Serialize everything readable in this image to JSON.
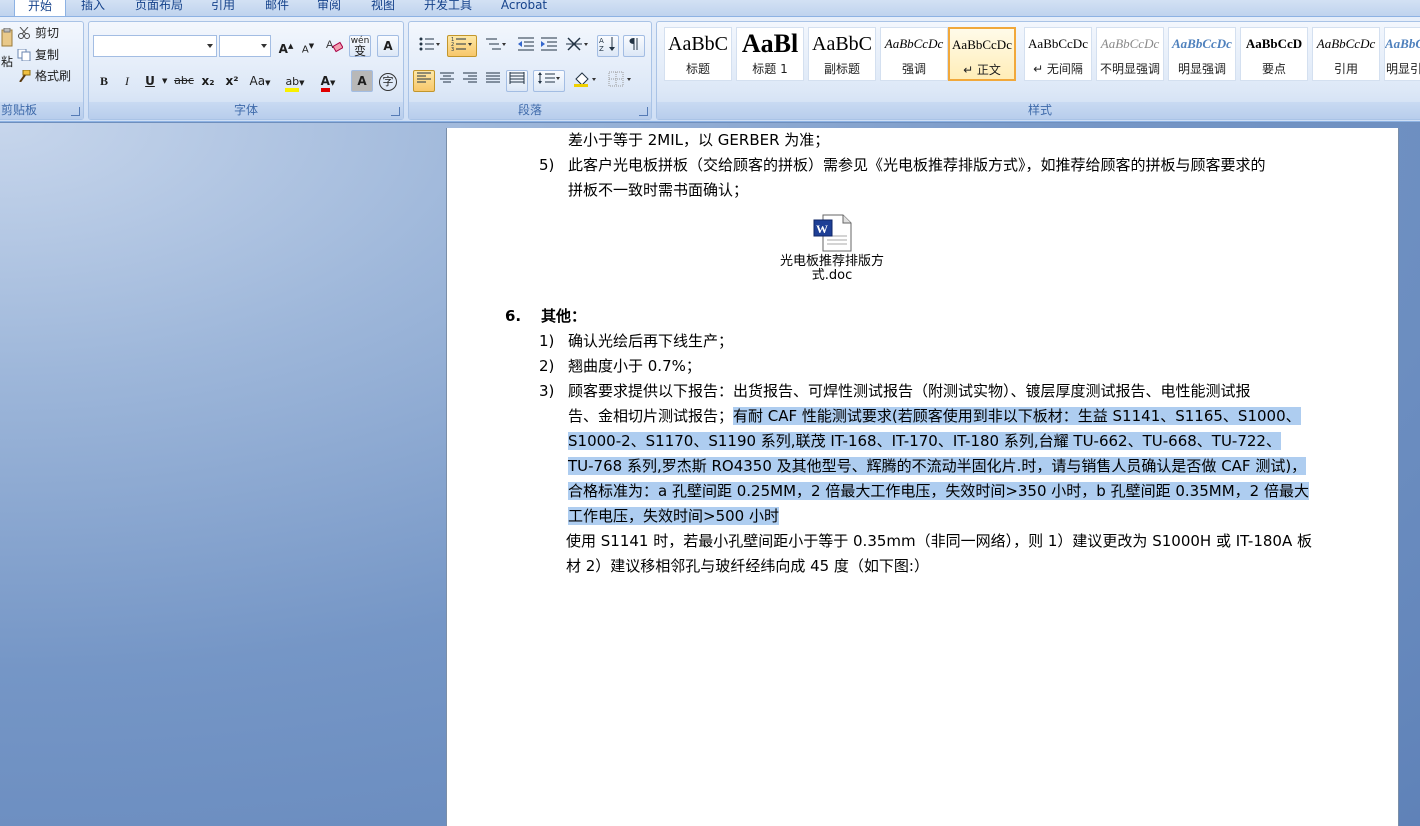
{
  "tabs": [
    "开始",
    "插入",
    "页面布局",
    "引用",
    "邮件",
    "审阅",
    "视图",
    "开发工具",
    "Acrobat"
  ],
  "clipboard": {
    "paste": "粘",
    "cut": "剪切",
    "copy": "复制",
    "format_painter": "格式刷",
    "group_label": "剪贴板"
  },
  "font": {
    "group_label": "字体",
    "grow": "A",
    "shrink": "A",
    "bold": "B",
    "italic": "I",
    "underline": "U",
    "strike": "abc",
    "subscript": "x₂",
    "superscript": "x²",
    "case": "Aa",
    "highlight": "ab",
    "color": "A",
    "pinyin": "wén",
    "border_a": "A",
    "shade_a": "A",
    "circle": "字"
  },
  "paragraph": {
    "group_label": "段落"
  },
  "styles": {
    "group_label": "样式",
    "items": [
      {
        "sample": "AaBbC",
        "name": "标题"
      },
      {
        "sample": "AaBl",
        "name": "标题 1"
      },
      {
        "sample": "AaBbC",
        "name": "副标题"
      },
      {
        "sample": "AaBbCcDc",
        "name": "强调"
      },
      {
        "sample": "AaBbCcDc",
        "name": "↵ 正文"
      },
      {
        "sample": "AaBbCcDc",
        "name": "↵ 无间隔"
      },
      {
        "sample": "AaBbCcDc",
        "name": "不明显强调"
      },
      {
        "sample": "AaBbCcDc",
        "name": "明显强调"
      },
      {
        "sample": "AaBbCcD",
        "name": "要点"
      },
      {
        "sample": "AaBbCcDc",
        "name": "引用"
      },
      {
        "sample": "AaBbCcDc",
        "name": "明显引"
      }
    ]
  },
  "document": {
    "line_top": "差小于等于 2MIL，以 GERBER 为准；",
    "item5_num": "5)",
    "item5_l1": "此客户光电板拼板（交给顾客的拼板）需参见《光电板推荐排版方式》，如推荐给顾客的拼板与顾客要求的",
    "item5_l2": "拼板不一致时需书面确认；",
    "attachment_l1": "光电板推荐排版方",
    "attachment_l2": "式.doc",
    "section_num": "6.",
    "section_title": "其他：",
    "o1_num": "1)",
    "o1": "确认光绘后再下线生产；",
    "o2_num": "2)",
    "o2": "翘曲度小于 0.7%；",
    "o3_num": "3)",
    "o3_l1": "顾客要求提供以下报告：出货报告、可焊性测试报告（附测试实物）、镀层厚度测试报告、电性能测试报",
    "o3_l2a": "告、金相切片测试报告；",
    "o3_l2b": "有耐 CAF 性能测试要求(若顾客使用到非以下板材：生益 S1141、S1165、S1000、",
    "o3_l3": "S1000-2、S1170、S1190 系列,联茂 IT-168、IT-170、IT-180 系列,台耀 TU-662、TU-668、TU-722、",
    "o3_l4": "TU-768 系列,罗杰斯  RO4350 及其他型号、辉腾的不流动半固化片.时，请与销售人员确认是否做 CAF 测试)，",
    "o3_l5": "合格标准为：a  孔壁间距 0.25MM，2 倍最大工作电压，失效时间>350 小时，b  孔壁间距 0.35MM，2 倍最大",
    "o3_l6": "工作电压，失效时间>500 小时",
    "use_l1": "使用 S1141 时，若最小孔壁间距小于等于 0.35mm（非同一网络），则  1）建议更改为 S1000H 或 IT-180A 板",
    "use_l2": "材       2）建议移相邻孔与玻纤经纬向成 45 度（如下图:）"
  }
}
